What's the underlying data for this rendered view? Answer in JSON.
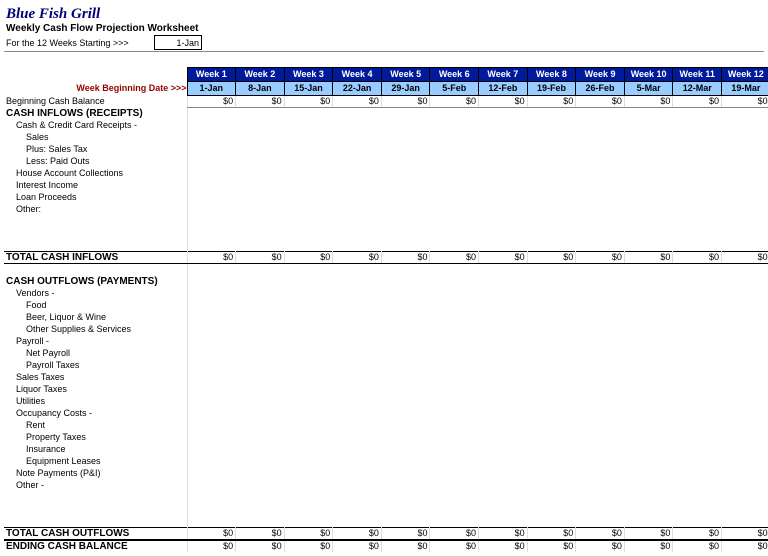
{
  "title": "Blue Fish Grill",
  "subtitle": "Weekly Cash Flow Projection Worksheet",
  "start_label": "For the 12 Weeks Starting >>>",
  "start_value": "1-Jan",
  "header_week_label": "Week Beginning Date >>>",
  "weeks": [
    {
      "wk": "Week 1",
      "date": "1-Jan"
    },
    {
      "wk": "Week 2",
      "date": "8-Jan"
    },
    {
      "wk": "Week 3",
      "date": "15-Jan"
    },
    {
      "wk": "Week 4",
      "date": "22-Jan"
    },
    {
      "wk": "Week 5",
      "date": "29-Jan"
    },
    {
      "wk": "Week 6",
      "date": "5-Feb"
    },
    {
      "wk": "Week 7",
      "date": "12-Feb"
    },
    {
      "wk": "Week 8",
      "date": "19-Feb"
    },
    {
      "wk": "Week 9",
      "date": "26-Feb"
    },
    {
      "wk": "Week 10",
      "date": "5-Mar"
    },
    {
      "wk": "Week 11",
      "date": "12-Mar"
    },
    {
      "wk": "Week 12",
      "date": "19-Mar"
    }
  ],
  "rows": {
    "beginning": "Beginning Cash Balance",
    "inflows_hdr": "CASH INFLOWS (RECEIPTS)",
    "cc": "Cash & Credit Card Receipts -",
    "sales": "Sales",
    "plus_tax": "Plus: Sales Tax",
    "less_paid": "Less: Paid Outs",
    "house": "House Account Collections",
    "interest": "Interest Income",
    "loan": "Loan Proceeds",
    "other_in": "Other:",
    "total_in": "TOTAL CASH INFLOWS",
    "outflows_hdr": "CASH OUTFLOWS (PAYMENTS)",
    "vendors": "Vendors -",
    "food": "Food",
    "beer": "Beer, Liquor & Wine",
    "supplies": "Other Supplies & Services",
    "payroll": "Payroll -",
    "net_payroll": "Net Payroll",
    "payroll_taxes": "Payroll Taxes",
    "sales_taxes": "Sales Taxes",
    "liquor_taxes": "Liquor Taxes",
    "utilities": "Utilities",
    "occupancy": "Occupancy Costs -",
    "rent": "Rent",
    "prop_taxes": "Property Taxes",
    "insurance": "Insurance",
    "equip": "Equipment Leases",
    "notes": "Note Payments (P&I)",
    "other_out": "Other -",
    "total_out": "TOTAL CASH OUTFLOWS",
    "ending": "ENDING CASH BALANCE"
  },
  "zeros": [
    "$0",
    "$0",
    "$0",
    "$0",
    "$0",
    "$0",
    "$0",
    "$0",
    "$0",
    "$0",
    "$0",
    "$0"
  ],
  "chart_data": {
    "type": "table",
    "title": "Weekly Cash Flow Projection Worksheet",
    "columns": [
      "Week 1",
      "Week 2",
      "Week 3",
      "Week 4",
      "Week 5",
      "Week 6",
      "Week 7",
      "Week 8",
      "Week 9",
      "Week 10",
      "Week 11",
      "Week 12"
    ],
    "dates": [
      "1-Jan",
      "8-Jan",
      "15-Jan",
      "22-Jan",
      "29-Jan",
      "5-Feb",
      "12-Feb",
      "19-Feb",
      "26-Feb",
      "5-Mar",
      "12-Mar",
      "19-Mar"
    ],
    "rows": [
      {
        "label": "Beginning Cash Balance",
        "values": [
          0,
          0,
          0,
          0,
          0,
          0,
          0,
          0,
          0,
          0,
          0,
          0
        ]
      },
      {
        "label": "TOTAL CASH INFLOWS",
        "values": [
          0,
          0,
          0,
          0,
          0,
          0,
          0,
          0,
          0,
          0,
          0,
          0
        ]
      },
      {
        "label": "TOTAL CASH OUTFLOWS",
        "values": [
          0,
          0,
          0,
          0,
          0,
          0,
          0,
          0,
          0,
          0,
          0,
          0
        ]
      },
      {
        "label": "ENDING CASH BALANCE",
        "values": [
          0,
          0,
          0,
          0,
          0,
          0,
          0,
          0,
          0,
          0,
          0,
          0
        ]
      }
    ]
  }
}
